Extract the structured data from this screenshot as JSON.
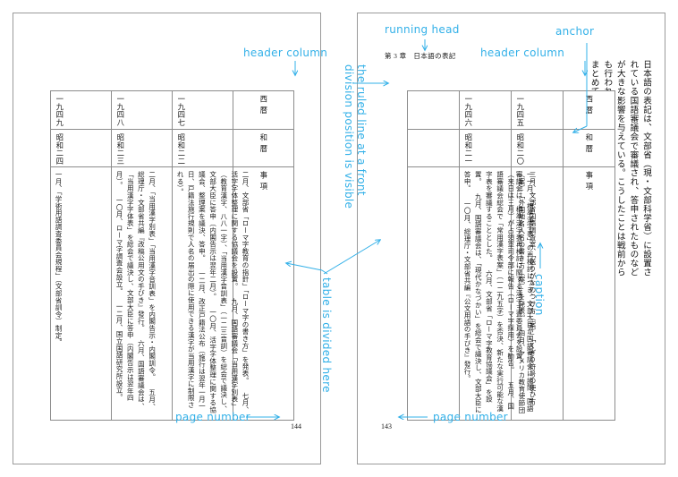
{
  "document": {
    "kind": "book-spread",
    "accent_color": "#32b0e8",
    "rule_color": "#8c8c8c",
    "page_border_color": "#9a9a9a"
  },
  "left_page": {
    "page_number": "144",
    "table": {
      "header_column": [
        "西暦",
        "和暦",
        "事項"
      ],
      "columns": [
        {
          "seireki": "一九四七",
          "wareki": "昭和二二",
          "items": "二月、文部省「ローマ字教育の指針」「ローマ字の書き方」を発表。\n七月、活字字体整理に関する協議会を設置。\n九月、国語審議会「当用漢字別表」（教育漢字、八八一字）、「当用漢字音訓表」（一二三音訓）を総会で議決し、文部大臣に答申（内閣告示は翌年二月）。\n一〇月、活字字体整理に関する協議会、整理案を議決、答申。\n一二月、改正戸籍法公布（施行は翌年一月一日、戸籍法施行規則で人名の届出の際に使用できる漢字が当用漢字に制限される）。"
        },
        {
          "seireki": "一九四八",
          "wareki": "昭和二三",
          "items": "二月、「当用漢字別表」「当用漢字音訓表」を内閣告示・内閣訓令。\n五月、総理庁・文部省共編『改稿公用文の手びき』發行。\n六月、国語審議会は、「当用漢字字体表」を総会で議決し、文部大臣に答申（内閣告示は翌年四月）。\n一〇月、ローマ字調査会設立。\n一二月、国立国語研究所設立。"
        },
        {
          "seireki": "一九四九",
          "wareki": "昭和二四",
          "items": "一月、「学術用語調査委員会規程」（文部省訓令）制定。"
        }
      ]
    }
  },
  "right_page": {
    "page_number": "143",
    "running_head": "第 3 章　日本語の表記",
    "body_text": "日本語の表記は、文部省（現・文部科学省）に設置されている国語審議会で審議され、答申されたものなどが大きな影響を与えている。こうしたことは戦前からも行われていたが、今日の表記に関連する主な流れをまとめてみた。",
    "caption": "表5　戦後における日本語表記に関連する主な流れ",
    "table": {
      "header_column": [
        "西暦",
        "和暦",
        "事項"
      ],
      "columns": [
        {
          "seireki": "一九四五",
          "wareki": "昭和二〇",
          "items": "一一月、「標準漢字表」の再検討につき、文部大臣が国語審議会に諮問。国語審議会は、標準漢字表再検討に関する漢字主査委員会を設置。"
        },
        {
          "seireki": "一九四六",
          "wareki": "昭和二一",
          "items": "三月、文部省国語調査室、「送りがなのつけ方（案）」「くぎり符号の使ひ方（案）」「外国地名人名の書き方（案）」を発表。\n四月、アメリカ教育使節団（来日は三月）が占領軍司令部に報告（ローマ字採用）を勧告。\n五月、国語審議会総会で「常用漢字表案」（一二九五字）を否決、新たな実行可能な漢字表を審議することとした。\n六月、文部省「ローマ字教育協議会」を設置。\n九月、国語審議会は、「現代かなづかい」を総会で議決し、文部大臣に答申。\n一〇月、総理庁・文部省共編『公文用語の手びき』發行。"
        }
      ]
    }
  },
  "annotations": [
    {
      "name": "header-column-left",
      "label": "header column"
    },
    {
      "name": "header-column-right",
      "label": "header column"
    },
    {
      "name": "running-head",
      "label": "running head"
    },
    {
      "name": "anchor",
      "label": "anchor"
    },
    {
      "name": "caption",
      "label": "caption"
    },
    {
      "name": "page-number-left",
      "label": "page number"
    },
    {
      "name": "page-number-right",
      "label": "page number"
    },
    {
      "name": "table-divided",
      "label": "table is divided here"
    },
    {
      "name": "ruled-line-front",
      "label": "the ruled line at a front\ndivision position is visible"
    }
  ]
}
